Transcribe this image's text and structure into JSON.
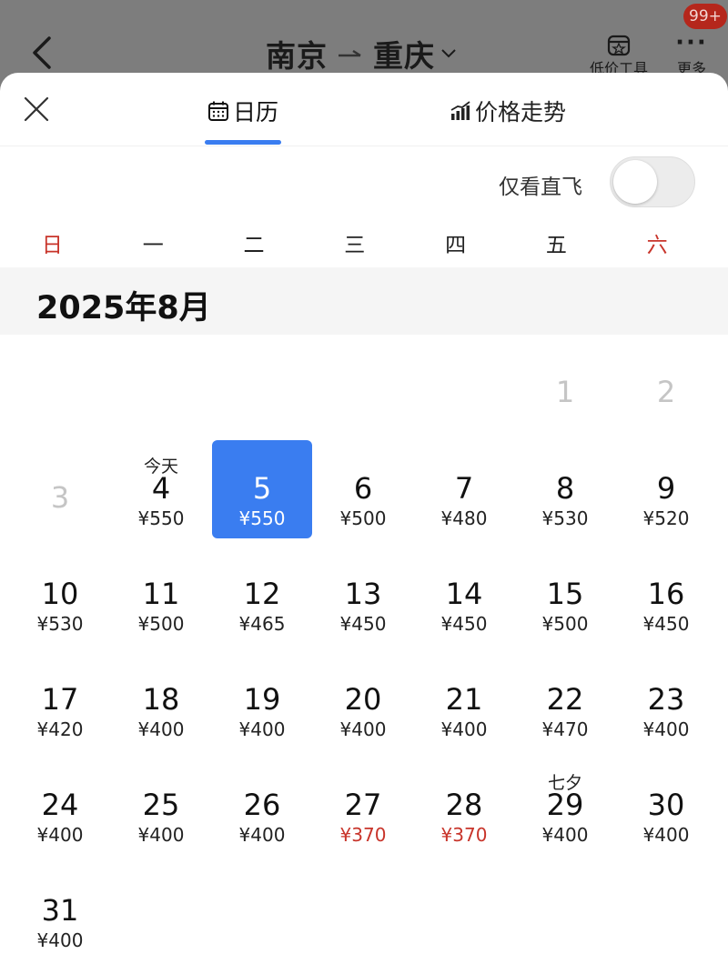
{
  "header": {
    "origin": "南京",
    "destination": "重庆",
    "low_price_tool_label": "低价工具",
    "more_label": "更多",
    "more_dots": "···",
    "badge_count": "99+"
  },
  "sheet": {
    "tabs": [
      {
        "id": "calendar",
        "label": "日历",
        "active": true
      },
      {
        "id": "trend",
        "label": "价格走势",
        "active": false
      }
    ],
    "direct_only_label": "仅看直飞",
    "direct_only_on": false,
    "accent_color": "#3a7df0",
    "low_price_color": "#c8342a"
  },
  "weekdays": [
    "日",
    "一",
    "二",
    "三",
    "四",
    "五",
    "六"
  ],
  "month": {
    "title": "2025年8月",
    "first_weekday": 5,
    "days": [
      {
        "day": "1",
        "price": "",
        "disabled": true
      },
      {
        "day": "2",
        "price": "",
        "disabled": true
      },
      {
        "day": "3",
        "price": "",
        "disabled": true
      },
      {
        "day": "4",
        "price": "¥550",
        "label": "今天"
      },
      {
        "day": "5",
        "price": "¥550",
        "selected": true
      },
      {
        "day": "6",
        "price": "¥500"
      },
      {
        "day": "7",
        "price": "¥480"
      },
      {
        "day": "8",
        "price": "¥530"
      },
      {
        "day": "9",
        "price": "¥520"
      },
      {
        "day": "10",
        "price": "¥530"
      },
      {
        "day": "11",
        "price": "¥500"
      },
      {
        "day": "12",
        "price": "¥465"
      },
      {
        "day": "13",
        "price": "¥450"
      },
      {
        "day": "14",
        "price": "¥450"
      },
      {
        "day": "15",
        "price": "¥500"
      },
      {
        "day": "16",
        "price": "¥450"
      },
      {
        "day": "17",
        "price": "¥420"
      },
      {
        "day": "18",
        "price": "¥400"
      },
      {
        "day": "19",
        "price": "¥400"
      },
      {
        "day": "20",
        "price": "¥400"
      },
      {
        "day": "21",
        "price": "¥400"
      },
      {
        "day": "22",
        "price": "¥470"
      },
      {
        "day": "23",
        "price": "¥400"
      },
      {
        "day": "24",
        "price": "¥400"
      },
      {
        "day": "25",
        "price": "¥400"
      },
      {
        "day": "26",
        "price": "¥400"
      },
      {
        "day": "27",
        "price": "¥370",
        "cheap": true
      },
      {
        "day": "28",
        "price": "¥370",
        "cheap": true
      },
      {
        "day": "29",
        "price": "¥400",
        "label": "七夕"
      },
      {
        "day": "30",
        "price": "¥400"
      },
      {
        "day": "31",
        "price": "¥400"
      }
    ]
  }
}
